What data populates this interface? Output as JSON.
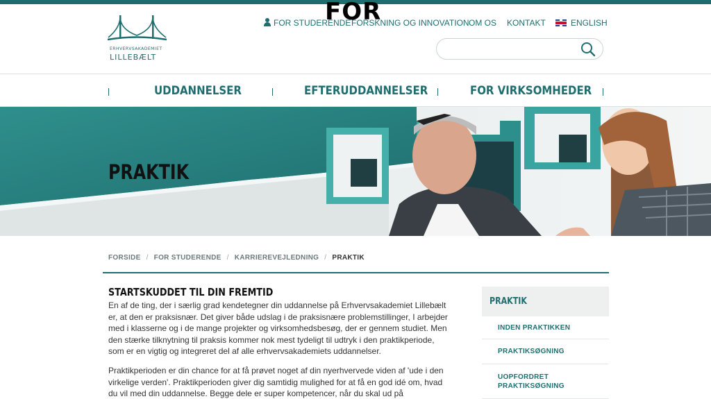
{
  "overlay_text": "FOR",
  "brand": {
    "name_small": "ERHVERVSAKADEMIET",
    "name_big": "LILLEBÆLT",
    "accent_color": "#1e6e6f"
  },
  "utility_nav": {
    "students": "FOR STUDERENDE",
    "research": "FORSKNING OG INNOVATION",
    "about": "OM OS",
    "contact": "KONTAKT",
    "english": "ENGLISH"
  },
  "search": {
    "placeholder": "",
    "value": ""
  },
  "main_nav": {
    "items": [
      "UDDANNELSER",
      "EFTERUDDANNELSER",
      "FOR VIRKSOMHEDER"
    ]
  },
  "hero": {
    "title": "PRAKTIK"
  },
  "breadcrumb": {
    "items": [
      "FORSIDE",
      "FOR STUDERENDE",
      "KARRIEREVEJLEDNING",
      "PRAKTIK"
    ]
  },
  "content": {
    "title": "STARTSKUDDET TIL DIN FREMTID",
    "paragraph1": "En af de ting, der i særlig grad kendetegner din uddannelse på Erhvervsakademiet Lillebælt er, at den er praksisnær. Det giver både udslag i de praksisnære problemstillinger, I arbejder med i klasserne og i de mange projekter og virksomhedsbesøg, der er gennem studiet. Men den stærke tilknytning til praksis kommer nok mest tydeligt til udtryk i den praktikperiode, som er en vigtig og integreret del af alle erhvervsakademiets uddannelser.",
    "paragraph2": "Praktikperioden er din chance for at få prøvet noget af din nyerhvervede viden af 'ude i den virkelige verden'. Praktikperioden giver dig samtidig mulighed for at få en god idé om, hvad du vil med din uddannelse. Begge dele er super kompetencer, når du skal ud på jobmarkedet"
  },
  "sidebar": {
    "heading": "PRAKTIK",
    "items": [
      "INDEN PRAKTIKKEN",
      "PRAKTIKSØGNING",
      "UOPFORDRET PRAKTIKSØGNING"
    ]
  }
}
